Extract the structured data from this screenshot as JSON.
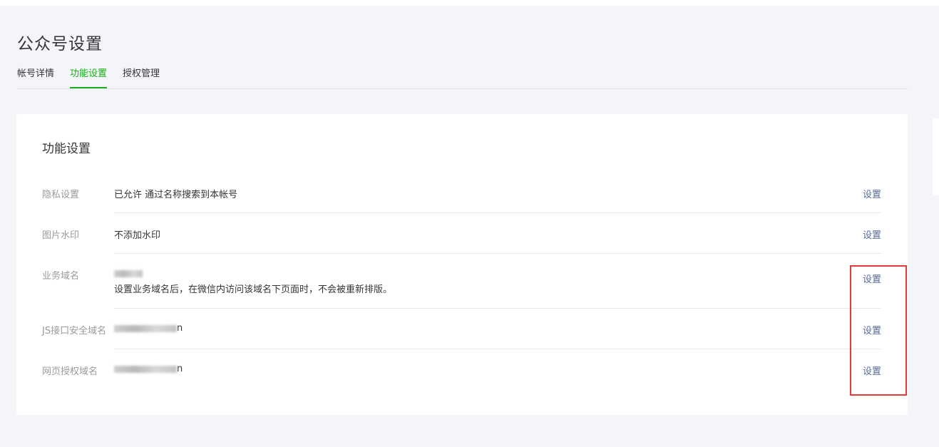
{
  "page": {
    "title": "公众号设置"
  },
  "tabs": [
    {
      "label": "帐号详情",
      "active": false
    },
    {
      "label": "功能设置",
      "active": true
    },
    {
      "label": "授权管理",
      "active": false
    }
  ],
  "card": {
    "title": "功能设置",
    "rows": [
      {
        "label": "隐私设置",
        "value": "已允许 通过名称搜索到本帐号",
        "action": "设置"
      },
      {
        "label": "图片水印",
        "value": "不添加水印",
        "action": "设置"
      },
      {
        "label": "业务域名",
        "value": "",
        "note": "设置业务域名后，在微信内访问该域名下页面时，不会被重新排版。",
        "action": "设置"
      },
      {
        "label": "JS接口安全域名",
        "value": "",
        "value_suffix": "n",
        "action": "设置"
      },
      {
        "label": "网页授权域名",
        "value": "",
        "value_suffix": "n",
        "action": "设置"
      }
    ]
  },
  "colors": {
    "accent_green": "#1aad19",
    "link_blue": "#576b95",
    "highlight_red": "#e53935",
    "background": "#f4f5f9"
  }
}
